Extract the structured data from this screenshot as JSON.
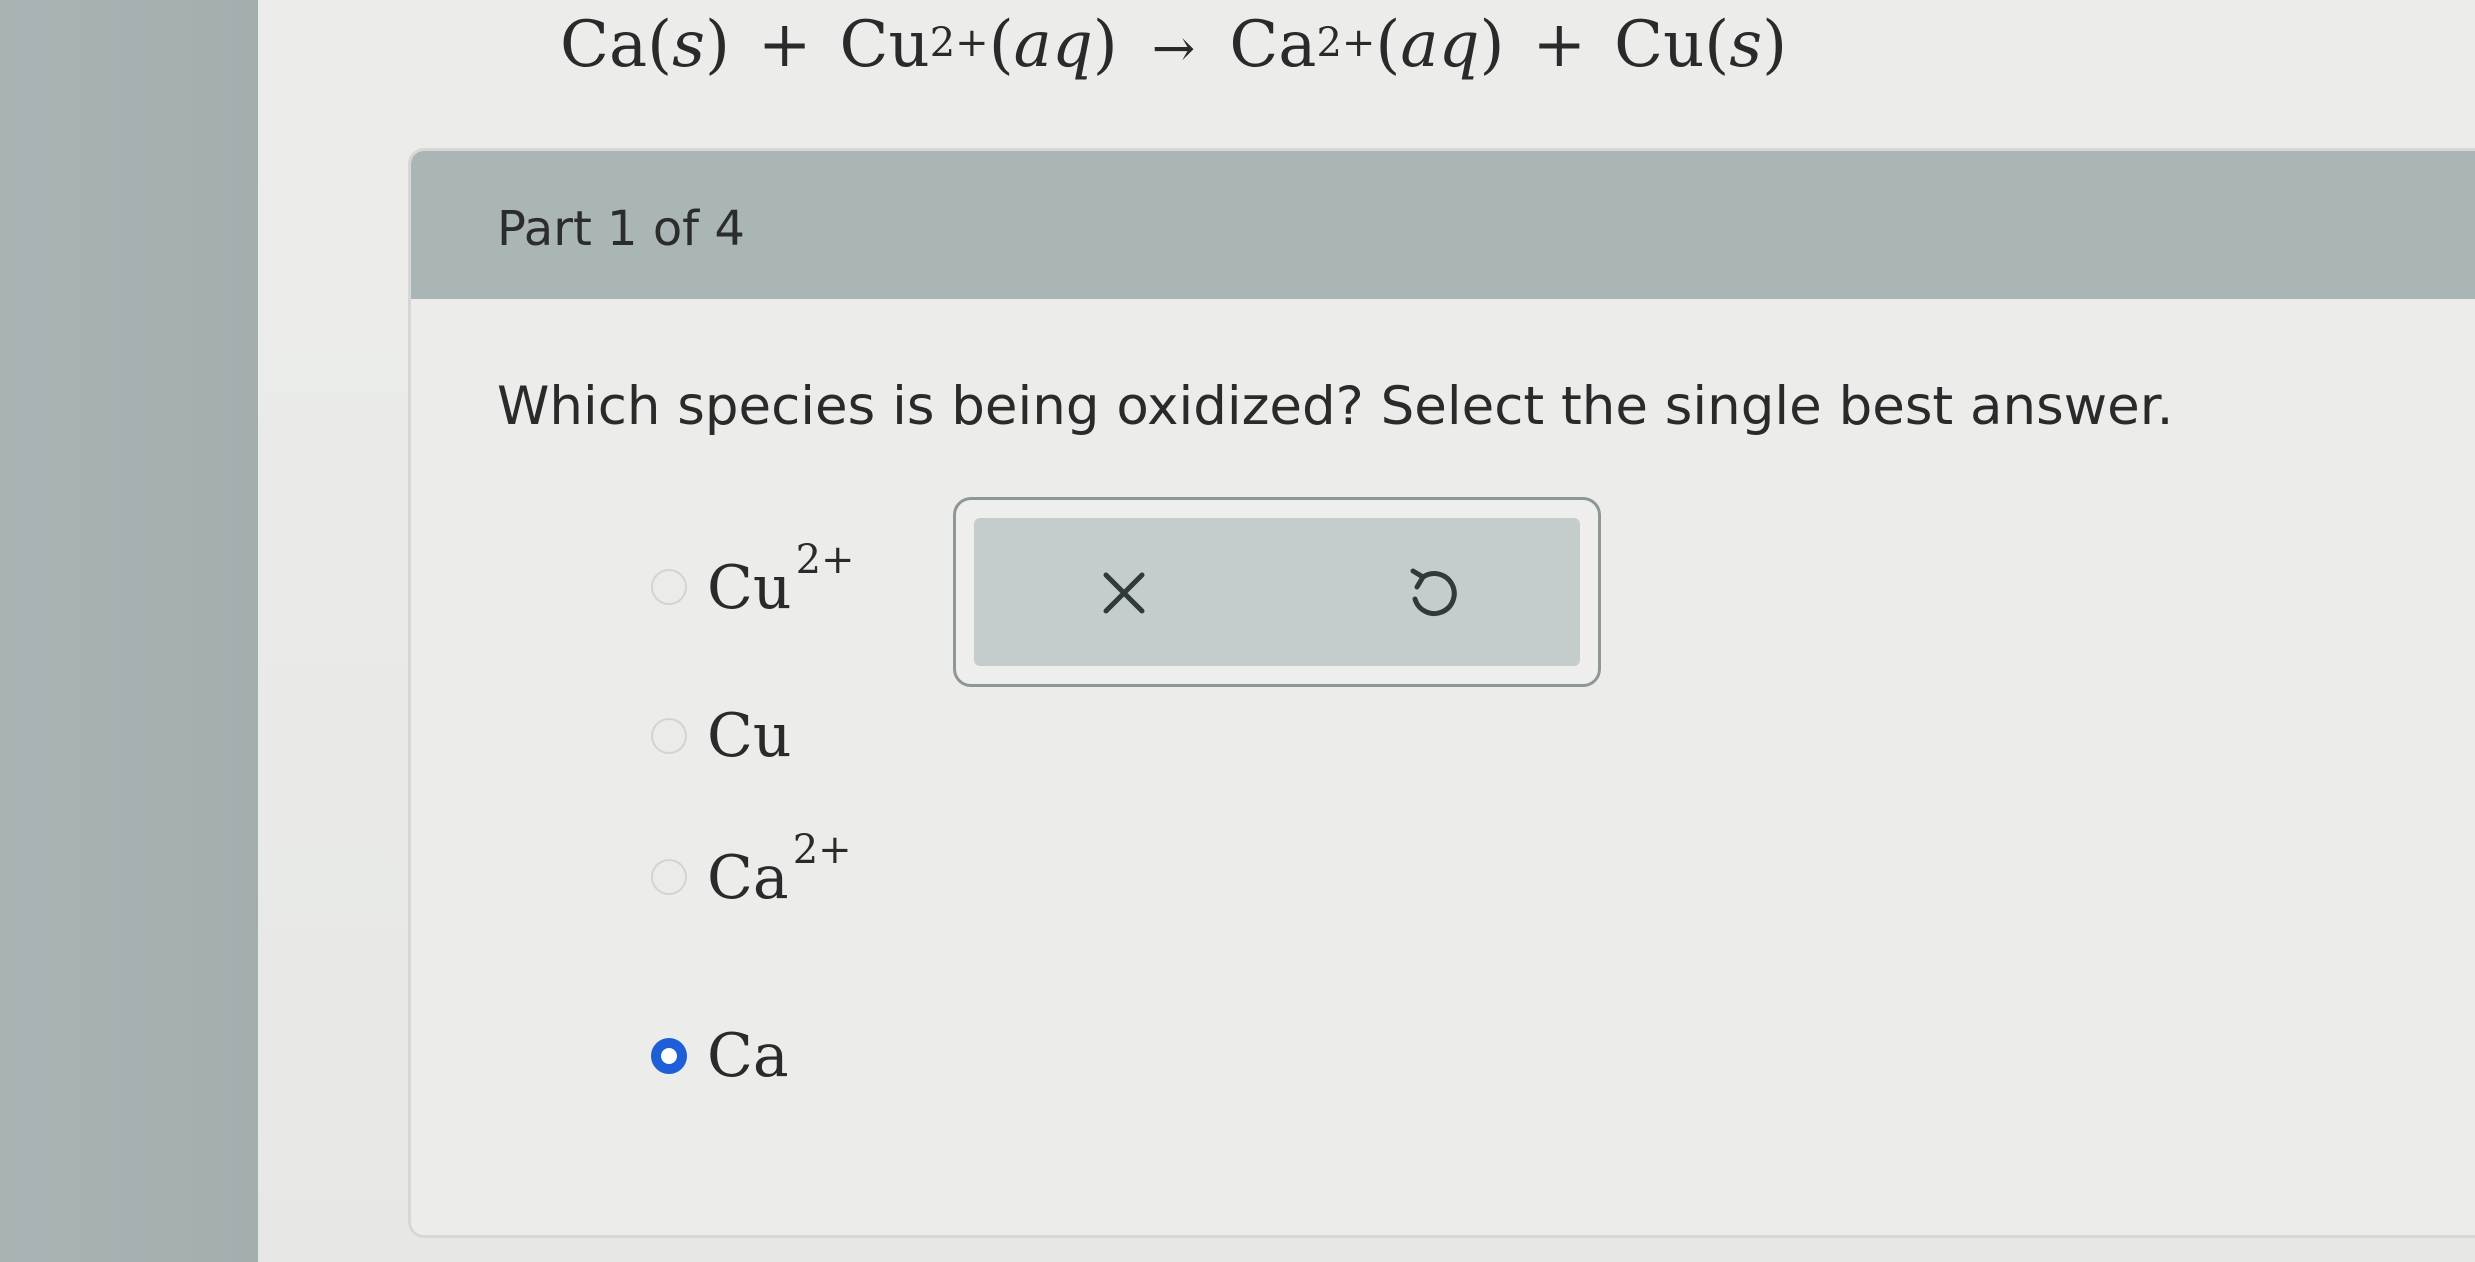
{
  "equation": {
    "ca_s": "Ca",
    "s1": "s",
    "plus1": "+",
    "cu": "Cu",
    "cu_charge": "2+",
    "aq1": "aq",
    "arrow": "→",
    "ca": "Ca",
    "ca_charge": "2+",
    "aq2": "aq",
    "plus2": "+",
    "cu_s": "Cu",
    "s2": "s"
  },
  "part": {
    "label": "Part 1 of 4"
  },
  "question": {
    "text": "Which species is being oxidized? Select the single best answer."
  },
  "options": [
    {
      "label": "Cu",
      "charge": "2+",
      "selected": false
    },
    {
      "label": "Cu",
      "charge": "",
      "selected": false
    },
    {
      "label": "Ca",
      "charge": "2+",
      "selected": false
    },
    {
      "label": "Ca",
      "charge": "",
      "selected": true
    }
  ],
  "actions": {
    "clear_icon": "close-icon",
    "undo_icon": "undo-icon"
  },
  "colors": {
    "selected_radio": "#1e5fd8",
    "header_bg": "#aab6b5"
  }
}
